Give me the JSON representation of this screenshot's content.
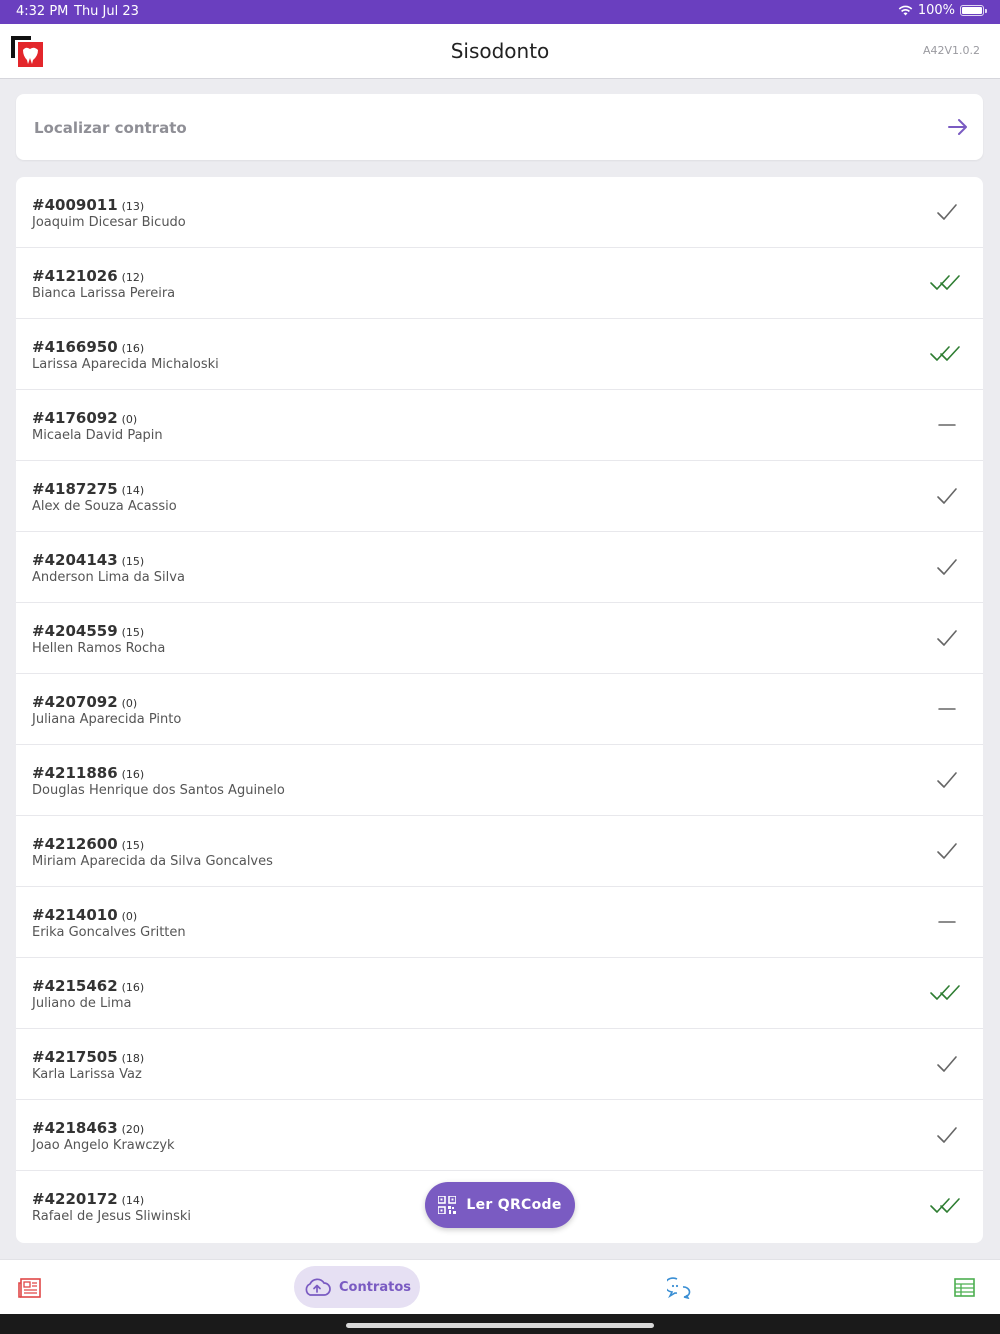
{
  "status_bar": {
    "time": "4:32 PM",
    "date": "Thu Jul 23",
    "battery": "100%"
  },
  "header": {
    "title": "Sisodonto",
    "version": "A42V1.0.2"
  },
  "search": {
    "placeholder": "Localizar contrato"
  },
  "contracts": [
    {
      "id": "#4009011",
      "count": "(13)",
      "name": "Joaquim Dicesar Bicudo",
      "status": "check"
    },
    {
      "id": "#4121026",
      "count": "(12)",
      "name": "Bianca Larissa Pereira",
      "status": "double-check"
    },
    {
      "id": "#4166950",
      "count": "(16)",
      "name": "Larissa Aparecida Michaloski",
      "status": "double-check"
    },
    {
      "id": "#4176092",
      "count": "(0)",
      "name": "Micaela David Papin",
      "status": "dash"
    },
    {
      "id": "#4187275",
      "count": "(14)",
      "name": "Alex de Souza Acassio",
      "status": "check"
    },
    {
      "id": "#4204143",
      "count": "(15)",
      "name": "Anderson Lima da Silva",
      "status": "check"
    },
    {
      "id": "#4204559",
      "count": "(15)",
      "name": "Hellen Ramos Rocha",
      "status": "check"
    },
    {
      "id": "#4207092",
      "count": "(0)",
      "name": "Juliana Aparecida Pinto",
      "status": "dash"
    },
    {
      "id": "#4211886",
      "count": "(16)",
      "name": "Douglas Henrique dos Santos Aguinelo",
      "status": "check"
    },
    {
      "id": "#4212600",
      "count": "(15)",
      "name": "Miriam Aparecida da Silva Goncalves",
      "status": "check"
    },
    {
      "id": "#4214010",
      "count": "(0)",
      "name": "Erika Goncalves Gritten",
      "status": "dash"
    },
    {
      "id": "#4215462",
      "count": "(16)",
      "name": "Juliano de Lima",
      "status": "double-check"
    },
    {
      "id": "#4217505",
      "count": "(18)",
      "name": "Karla Larissa Vaz",
      "status": "check"
    },
    {
      "id": "#4218463",
      "count": "(20)",
      "name": "Joao Angelo Krawczyk",
      "status": "check"
    },
    {
      "id": "#4220172",
      "count": "(14)",
      "name": "Rafael de Jesus Sliwinski",
      "status": "double-check"
    }
  ],
  "qr_button": {
    "label": "Ler QRCode"
  },
  "tabs": {
    "active_label": "Contratos",
    "icons": [
      "newspaper-icon",
      "cloud-upload-icon",
      "chat-icon",
      "table-icon"
    ]
  },
  "colors": {
    "status_bar": "#6a3fbf",
    "accent": "#7a5bc2",
    "check_gray": "#666666",
    "double_check_green": "#2e7d32",
    "tab_red": "#e04848",
    "tab_blue": "#3b8fd4",
    "tab_green": "#4caf50"
  }
}
